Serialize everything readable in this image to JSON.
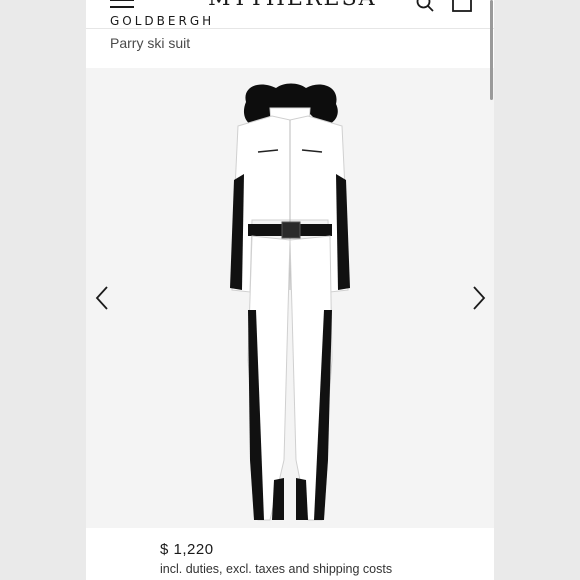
{
  "header": {
    "logo": "MYTHERESA",
    "brand_partial": "GOLDBERGH",
    "icons": [
      "menu-icon",
      "search-icon",
      "shopping-bag-icon"
    ]
  },
  "product": {
    "name": "Parry ski suit",
    "price": "$ 1,220",
    "price_note": "incl. duties, excl. taxes and shipping costs"
  },
  "gallery": {
    "prev_icon": "chevron-left-icon",
    "next_icon": "chevron-right-icon"
  }
}
